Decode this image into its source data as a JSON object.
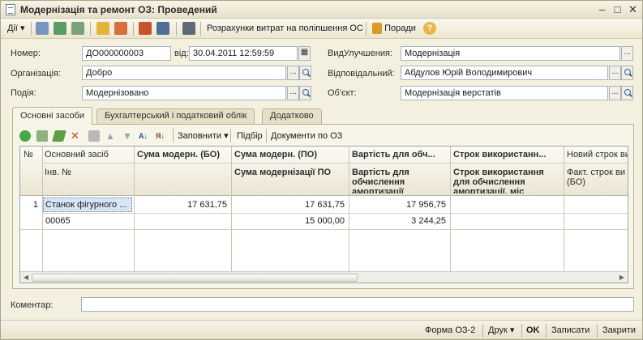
{
  "window": {
    "title": "Модернізація та ремонт ОЗ: Проведений"
  },
  "toolbar": {
    "actions_label": "Дії",
    "costs_label": "Розрахунки витрат на поліпшення ОС",
    "tips_label": "Поради"
  },
  "header": {
    "number_label": "Номер:",
    "number_value": "ДО000000003",
    "date_label": "від:",
    "date_value": "30.04.2011 12:59:59",
    "organization_label": "Організація:",
    "organization_value": "Добро",
    "event_label": "Подія:",
    "event_value": "Модернізовано",
    "improvement_type_label": "ВидУлучшения:",
    "improvement_type_value": "Модернізація",
    "responsible_label": "Відповідальний:",
    "responsible_value": "Абдулов Юрій Володимирович",
    "object_label": "Об'єкт:",
    "object_value": "Модернізація верстатів"
  },
  "tabs": [
    {
      "label": "Основні засоби"
    },
    {
      "label": "Бухгалтерський і податковий облік"
    },
    {
      "label": "Додатково"
    }
  ],
  "table_toolbar": {
    "fill_label": "Заповнити",
    "select_label": "Підбір",
    "documents_label": "Документи по ОЗ"
  },
  "table": {
    "headers_top": [
      "№",
      "Основний засіб",
      "Сума модерн. (БО)",
      "Сума модерн. (ПО)",
      "Вартість для обч...",
      "Строк використанн...",
      "Новий строк ви..."
    ],
    "headers_bottom": [
      "Інв. №",
      "Сума модернізації ПО",
      "Вартість для обчислення амортизації",
      "Строк використання для обчислення амортизації, міс",
      "Факт. строк ви (БО)"
    ],
    "rows": [
      {
        "n": "1",
        "asset": "Станок фігурного ...",
        "inv": "00065",
        "sum_bo": "17 631,75",
        "sum_po": "17 631,75",
        "sum_po2": "15 000,00",
        "cost": "17 956,75",
        "cost2": "3 244,25"
      }
    ]
  },
  "comment": {
    "label": "Коментар:",
    "value": ""
  },
  "footer": {
    "form_label": "Форма ОЗ-2",
    "print_label": "Друк",
    "ok_label": "OK",
    "save_label": "Записати",
    "close_label": "Закрити"
  }
}
